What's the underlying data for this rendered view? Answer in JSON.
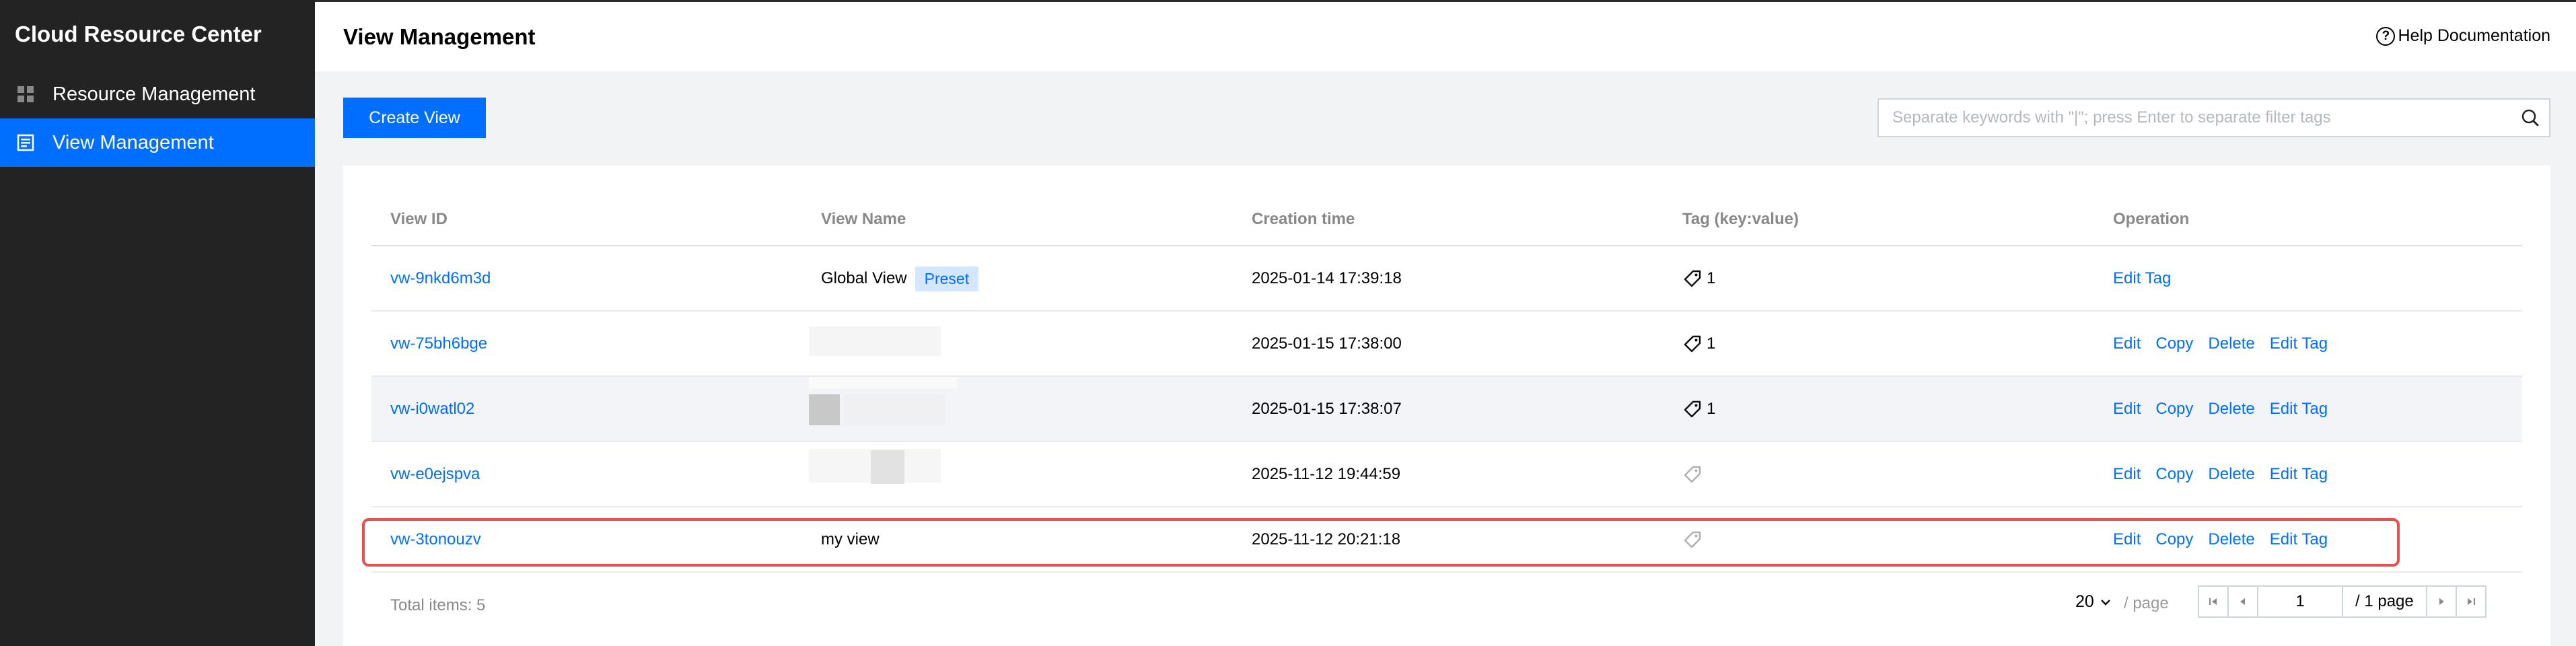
{
  "sidebar": {
    "title": "Cloud Resource Center",
    "items": [
      {
        "label": "Resource Management",
        "icon": "grid-icon",
        "active": false
      },
      {
        "label": "View Management",
        "icon": "list-icon",
        "active": true
      }
    ]
  },
  "header": {
    "title": "View Management",
    "help_label": "Help Documentation",
    "help_icon": "?"
  },
  "toolbar": {
    "create_label": "Create View",
    "search_placeholder": "Separate keywords with \"|\"; press Enter to separate filter tags",
    "search_value": ""
  },
  "table": {
    "headers": [
      "View ID",
      "View Name",
      "Creation time",
      "Tag (key:value)",
      "Operation"
    ],
    "rows": [
      {
        "id": "vw-9nkd6m3d",
        "name": "Global View",
        "badge": "Preset",
        "created": "2025-01-14 17:39:18",
        "tag_count": "1",
        "ops": [
          "Edit Tag"
        ]
      },
      {
        "id": "vw-75bh6bge",
        "name": "",
        "badge": "",
        "created": "2025-01-15 17:38:00",
        "tag_count": "1",
        "ops": [
          "Edit",
          "Copy",
          "Delete",
          "Edit Tag"
        ]
      },
      {
        "id": "vw-i0watl02",
        "name": "",
        "badge": "",
        "created": "2025-01-15 17:38:07",
        "tag_count": "1",
        "ops": [
          "Edit",
          "Copy",
          "Delete",
          "Edit Tag"
        ]
      },
      {
        "id": "vw-e0ejspva",
        "name": "",
        "badge": "",
        "created": "2025-11-12 19:44:59",
        "tag_count": "",
        "ops": [
          "Edit",
          "Copy",
          "Delete",
          "Edit Tag"
        ]
      },
      {
        "id": "vw-3tonouzv",
        "name": "my view",
        "badge": "",
        "created": "2025-11-12 20:21:18",
        "tag_count": "",
        "ops": [
          "Edit",
          "Copy",
          "Delete",
          "Edit Tag"
        ]
      }
    ]
  },
  "footer": {
    "total_label": "Total items:  5",
    "page_size": "20",
    "per_page_label": "/ page",
    "current_page": "1",
    "total_pages_label": "/ 1 page"
  },
  "colors": {
    "primary": "#006eff",
    "sidebar_bg": "#232323",
    "highlight_border": "#e8504e"
  }
}
